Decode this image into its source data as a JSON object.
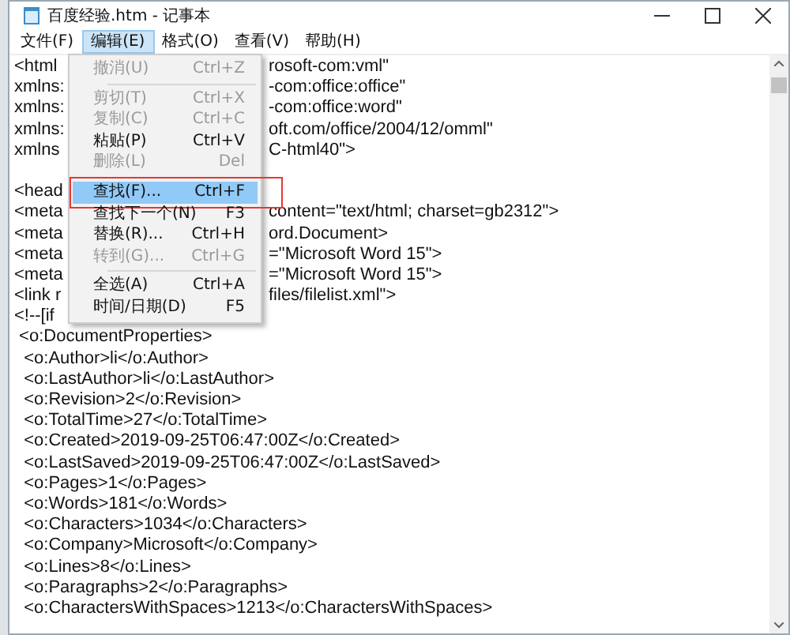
{
  "window": {
    "title": "百度经验.htm - 记事本"
  },
  "menubar": [
    {
      "label": "文件(F)",
      "selected": false
    },
    {
      "label": "编辑(E)",
      "selected": true
    },
    {
      "label": "格式(O)",
      "selected": false
    },
    {
      "label": "查看(V)",
      "selected": false
    },
    {
      "label": "帮助(H)",
      "selected": false
    }
  ],
  "menu": [
    {
      "kind": "item",
      "label": "撤消(U)",
      "shortcut": "Ctrl+Z",
      "disabled": true,
      "selected": false,
      "annotated": false
    },
    {
      "kind": "separator"
    },
    {
      "kind": "item",
      "label": "剪切(T)",
      "shortcut": "Ctrl+X",
      "disabled": true,
      "selected": false,
      "annotated": false
    },
    {
      "kind": "item",
      "label": "复制(C)",
      "shortcut": "Ctrl+C",
      "disabled": true,
      "selected": false,
      "annotated": false
    },
    {
      "kind": "item",
      "label": "粘贴(P)",
      "shortcut": "Ctrl+V",
      "disabled": false,
      "selected": false,
      "annotated": false
    },
    {
      "kind": "item",
      "label": "删除(L)",
      "shortcut": "Del",
      "disabled": true,
      "selected": false,
      "annotated": false
    },
    {
      "kind": "separator"
    },
    {
      "kind": "item",
      "label": "查找(F)...",
      "shortcut": "Ctrl+F",
      "disabled": false,
      "selected": true,
      "annotated": true
    },
    {
      "kind": "item",
      "label": "查找下一个(N)",
      "shortcut": "F3",
      "disabled": false,
      "selected": false,
      "annotated": false
    },
    {
      "kind": "item",
      "label": "替换(R)...",
      "shortcut": "Ctrl+H",
      "disabled": false,
      "selected": false,
      "annotated": false
    },
    {
      "kind": "item",
      "label": "转到(G)...",
      "shortcut": "Ctrl+G",
      "disabled": true,
      "selected": false,
      "annotated": false
    },
    {
      "kind": "separator"
    },
    {
      "kind": "item",
      "label": "全选(A)",
      "shortcut": "Ctrl+A",
      "disabled": false,
      "selected": false,
      "annotated": false
    },
    {
      "kind": "item",
      "label": "时间/日期(D)",
      "shortcut": "F5",
      "disabled": false,
      "selected": false,
      "annotated": false
    }
  ],
  "editor_blocks": [
    [
      {
        "left": "<html",
        "right": "rosoft-com:vml\""
      },
      {
        "left": "xmlns:",
        "right": "-com:office:office\""
      },
      {
        "left": "xmlns:",
        "right": "-com:office:word\""
      },
      {
        "left": "xmlns:",
        "right": "oft.com/office/2004/12/omml\""
      },
      {
        "left": "xmlns",
        "right": "C-html40\">"
      }
    ],
    [
      {
        "left": "<head"
      },
      {
        "left": "<meta",
        "right": "content=\"text/html; charset=gb2312\">"
      },
      {
        "left": "<meta",
        "right": "ord.Document>"
      },
      {
        "left": "<meta",
        "right": "=\"Microsoft Word 15\">"
      },
      {
        "left": "<meta",
        "right": "=\"Microsoft Word 15\">"
      },
      {
        "left": "<link r",
        "right": "files/filelist.xml\">"
      },
      {
        "left": "<!--[if"
      },
      {
        "left": " <o:DocumentProperties>"
      },
      {
        "left": "  <o:Author>li</o:Author>"
      },
      {
        "left": "  <o:LastAuthor>li</o:LastAuthor>"
      },
      {
        "left": "  <o:Revision>2</o:Revision>"
      },
      {
        "left": "  <o:TotalTime>27</o:TotalTime>"
      },
      {
        "left": "  <o:Created>2019-09-25T06:47:00Z</o:Created>"
      },
      {
        "left": "  <o:LastSaved>2019-09-25T06:47:00Z</o:LastSaved>"
      },
      {
        "left": "  <o:Pages>1</o:Pages>"
      },
      {
        "left": "  <o:Words>181</o:Words>"
      },
      {
        "left": "  <o:Characters>1034</o:Characters>"
      },
      {
        "left": "  <o:Company>Microsoft</o:Company>"
      },
      {
        "left": "  <o:Lines>8</o:Lines>"
      },
      {
        "left": "  <o:Paragraphs>2</o:Paragraphs>"
      },
      {
        "left": "  <o:CharactersWithSpaces>1213</o:CharactersWithSpaces>"
      }
    ]
  ]
}
